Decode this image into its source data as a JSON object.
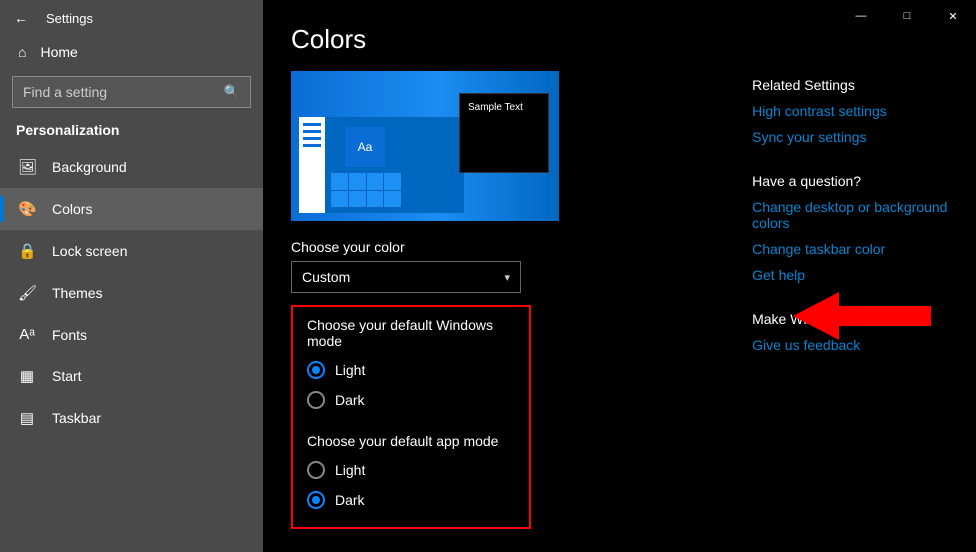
{
  "header": {
    "app_title": "Settings"
  },
  "sidebar": {
    "home": "Home",
    "search_placeholder": "Find a setting",
    "section": "Personalization",
    "items": [
      {
        "label": "Background"
      },
      {
        "label": "Colors"
      },
      {
        "label": "Lock screen"
      },
      {
        "label": "Themes"
      },
      {
        "label": "Fonts"
      },
      {
        "label": "Start"
      },
      {
        "label": "Taskbar"
      }
    ]
  },
  "page": {
    "title": "Colors",
    "preview_tile_text": "Aa",
    "preview_window_text": "Sample Text",
    "color_label": "Choose your color",
    "color_value": "Custom",
    "win_mode_label": "Choose your default Windows mode",
    "app_mode_label": "Choose your default app mode",
    "opt_light": "Light",
    "opt_dark": "Dark"
  },
  "right": {
    "related_title": "Related Settings",
    "high_contrast": "High contrast settings",
    "sync": "Sync your settings",
    "question_title": "Have a question?",
    "change_desktop": "Change desktop or background colors",
    "change_taskbar": "Change taskbar color",
    "get_help": "Get help",
    "make_better": "Make Windows better",
    "feedback": "Give us feedback"
  }
}
